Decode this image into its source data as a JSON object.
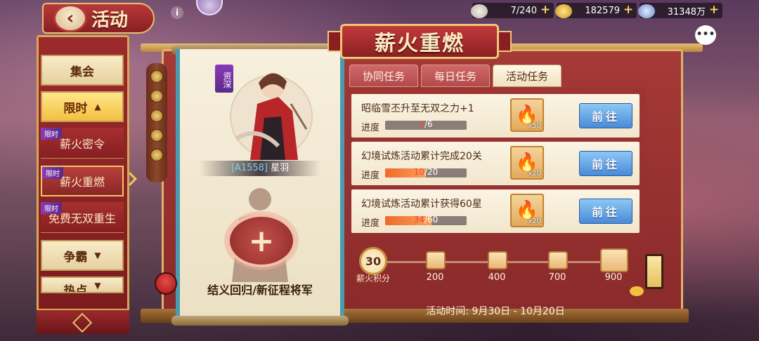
{
  "header": {
    "back_icon": "back-arrow-icon",
    "title": "活动",
    "info_icon": "info-icon"
  },
  "resources": [
    {
      "icon": "jade-icon",
      "value": "7/240"
    },
    {
      "icon": "gold-ingot-icon",
      "value": "182579"
    },
    {
      "icon": "coin-icon",
      "value": "31348万"
    }
  ],
  "menu": {
    "items": [
      {
        "label": "集会",
        "type": "category"
      },
      {
        "label": "限时",
        "type": "category-open",
        "chevron": "▲"
      },
      {
        "label": "薪火密令",
        "type": "sub",
        "tag": "限时"
      },
      {
        "label": "薪火重燃",
        "type": "sub-active",
        "tag": "限时"
      },
      {
        "label": "免费无双重生",
        "type": "sub",
        "tag": "限时"
      },
      {
        "label": "争霸",
        "type": "category",
        "chevron": "▼"
      },
      {
        "label": "热点",
        "type": "category",
        "chevron": "▼"
      }
    ]
  },
  "hero": {
    "tag": "资深",
    "code": "[A1558]",
    "name": "星羽"
  },
  "recruit": {
    "plus": "+",
    "text": "结义回归/新征程将军"
  },
  "banner": {
    "title": "薪火重燃"
  },
  "tabs": [
    {
      "label": "协同任务",
      "active": false
    },
    {
      "label": "每日任务",
      "active": false
    },
    {
      "label": "活动任务",
      "active": true
    }
  ],
  "tasks": [
    {
      "title": "昭临雪丕升至无双之力+1",
      "progress_label": "进度",
      "current": "0",
      "total": "/6",
      "fraction": 0.0,
      "reward_qty": "x50",
      "button": "前往"
    },
    {
      "title": "幻境试炼活动累计完成20关",
      "progress_label": "进度",
      "current": "10",
      "total": "/20",
      "fraction": 0.5,
      "reward_qty": "x20",
      "button": "前往"
    },
    {
      "title": "幻境试炼活动累计获得60星",
      "progress_label": "进度",
      "current": "34",
      "total": "/60",
      "fraction": 0.567,
      "reward_qty": "x20",
      "button": "前往"
    }
  ],
  "rewards": {
    "score": "30",
    "score_label": "薪火积分",
    "milestones": [
      "200",
      "400",
      "700",
      "900"
    ]
  },
  "activity_time": "活动时间:  9月30日 - 10月20日",
  "colors": {
    "accent_red": "#8a1f22",
    "gold": "#e2b26a",
    "go_button": "#4a8ad8",
    "progress_fill": "#f06a2a"
  }
}
